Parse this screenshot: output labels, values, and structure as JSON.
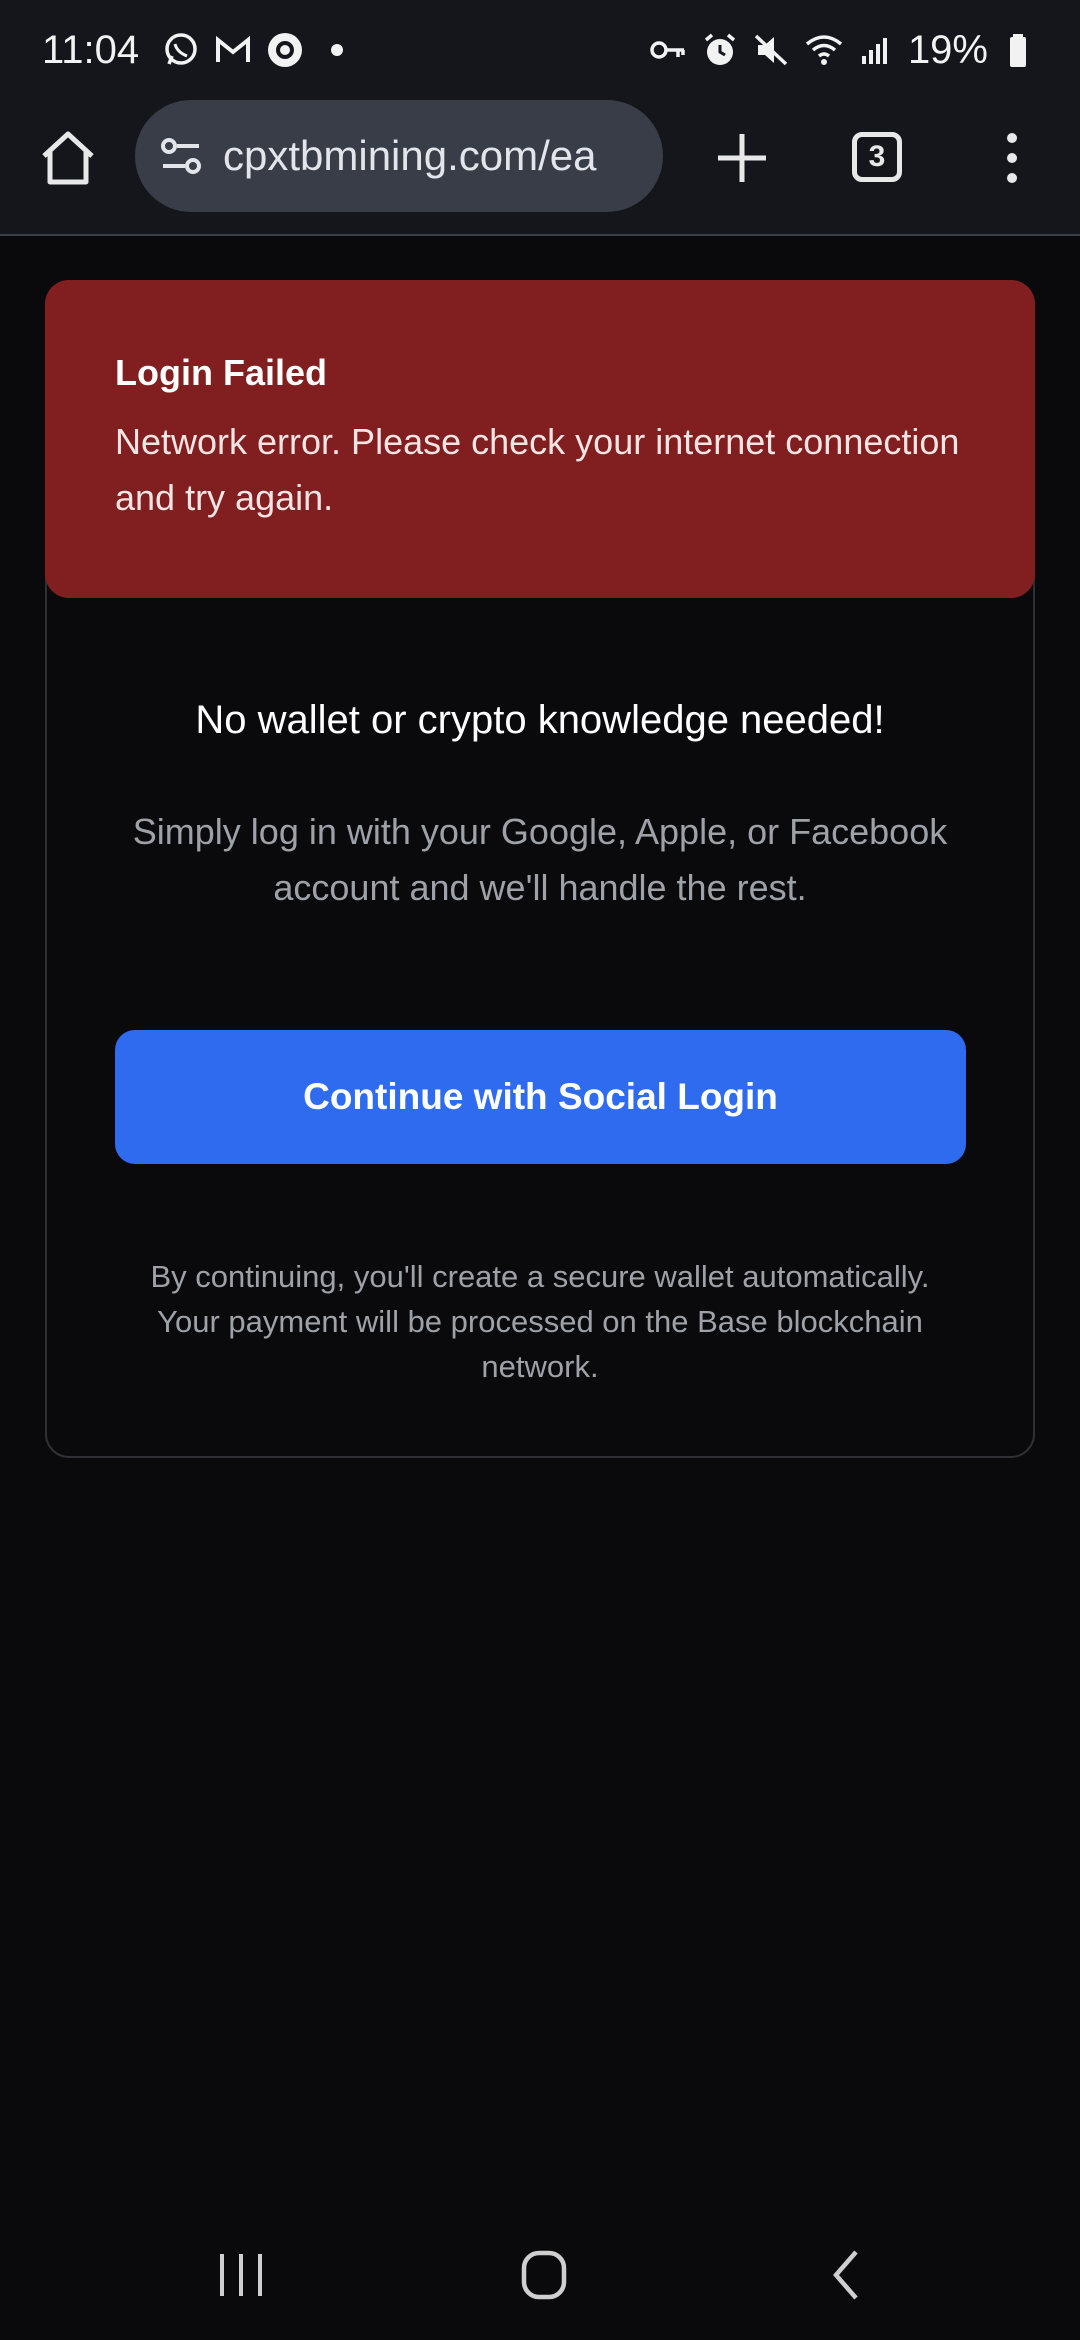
{
  "status_bar": {
    "time": "11:04",
    "battery_text": "19%",
    "left_icons": [
      "whatsapp-icon",
      "gmail-icon",
      "app-icon",
      "dot-icon"
    ],
    "right_icons": [
      "vpn-key-icon",
      "alarm-icon",
      "mute-icon",
      "wifi-icon",
      "signal-icon",
      "battery-icon"
    ]
  },
  "browser": {
    "url": "cpxtbmining.com/ea",
    "tab_count": "3"
  },
  "error": {
    "title": "Login Failed",
    "message": "Network error. Please check your internet connection and try again."
  },
  "content": {
    "headline": "No wallet or crypto knowledge needed!",
    "subtext": "Simply log in with your Google, Apple, or Facebook account and we'll handle the rest.",
    "button_label": "Continue with Social Login",
    "fineprint": "By continuing, you'll create a secure wallet automatically. Your payment will be processed on the Base blockchain network."
  },
  "colors": {
    "background": "#0a0a0c",
    "error_bg": "#811e1f",
    "button": "#2f6bef",
    "muted_text": "#9ea1a8"
  }
}
